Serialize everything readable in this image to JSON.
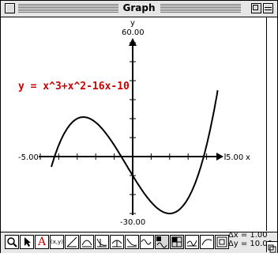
{
  "window": {
    "title": "Graph"
  },
  "graph": {
    "equation": "y = x^3+x^2-16x-10",
    "y_axis_name": "y",
    "x_axis_name": "x",
    "y_max_label": "60.00",
    "y_min_label": "-30.00",
    "x_min_label": "-5.00",
    "x_max_label": "5.00",
    "curve_color": "#000000",
    "equation_color": "#cc0000"
  },
  "chart_data": {
    "type": "line",
    "title": "",
    "function": "y = x^3+x^2-16x-10",
    "xlim": [
      -5,
      5
    ],
    "ylim": [
      -30,
      60
    ],
    "xlabel": "x",
    "ylabel": "y",
    "grid": false,
    "x": [
      -4.4,
      -4,
      -3.5,
      -3,
      -2.5,
      -2,
      -1.5,
      -1,
      -0.5,
      0,
      0.5,
      1,
      1.5,
      2,
      2.5,
      3,
      3.5,
      4,
      4.5
    ],
    "y": [
      -25.2,
      6,
      21.9,
      29,
      28.4,
      22,
      12.4,
      -4,
      -0.6,
      -10,
      -17.6,
      -24,
      -28.3,
      -30,
      -28.1,
      -22,
      -10.4,
      6,
      27.4
    ]
  },
  "status": {
    "dx": "Δx = 1.00",
    "dy": "Δy = 10.00"
  },
  "toolbar": {
    "tools": [
      "zoom-tool",
      "arrow-tool",
      "text-tool",
      "point-tool",
      "line-tool",
      "tangent-tool",
      "derivative-tool",
      "integral-tool",
      "area-tool",
      "sine-tool",
      "wave-tool",
      "table-tool",
      "axes-tool",
      "curve-tool",
      "graph-tool"
    ],
    "text_tool_glyph": "A",
    "point_tool_glyph": "(x,y)"
  }
}
